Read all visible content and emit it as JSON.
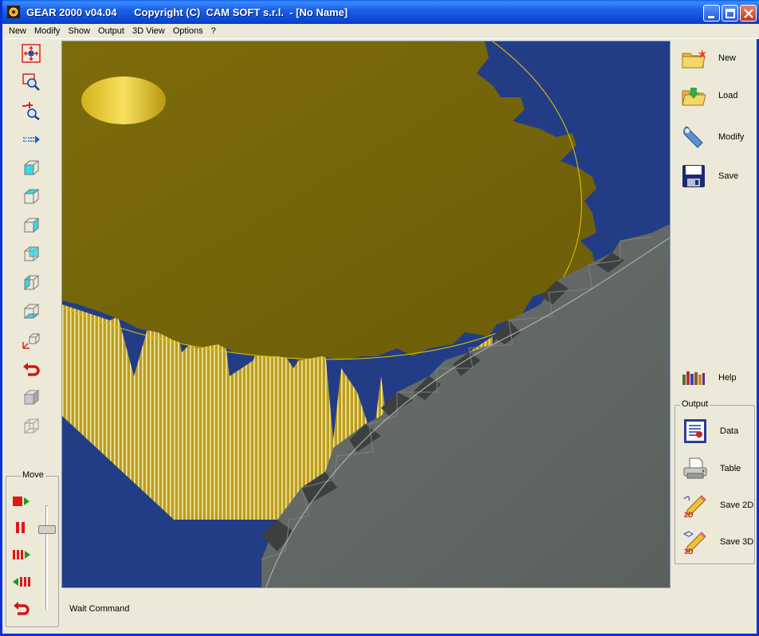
{
  "window": {
    "title": "GEAR 2000 v04.04      Copyright (C)  CAM SOFT s.r.l.  - [No Name]"
  },
  "menu": [
    "New",
    "Modify",
    "Show",
    "Output",
    "3D View",
    "Options",
    "?"
  ],
  "left_toolbar": {
    "icons": [
      "move-view-icon",
      "zoom-window-icon",
      "zoom-in-out-icon",
      "pan-arrow-icon",
      "view-front-icon",
      "view-top-icon",
      "view-right-icon",
      "view-iso-icon",
      "view-left-icon",
      "view-bottom-icon",
      "view-axes-icon",
      "undo-view-icon",
      "solid-cube-icon",
      "wireframe-cube-icon"
    ]
  },
  "move_panel": {
    "title": "Move",
    "buttons": [
      "record-play-icon",
      "pause-icon",
      "play-forward-icon",
      "play-backward-icon",
      "return-icon"
    ]
  },
  "status": {
    "text": "Wait Command"
  },
  "right_panel": {
    "buttons": [
      {
        "label": "New",
        "icon": "new-folder-icon"
      },
      {
        "label": "Load",
        "icon": "load-folder-icon"
      },
      {
        "label": "Modify",
        "icon": "wrench-icon"
      },
      {
        "label": "Save",
        "icon": "floppy-disk-icon"
      },
      {
        "label": "Help",
        "icon": "help-books-icon"
      }
    ],
    "output": {
      "title": "Output",
      "buttons": [
        {
          "label": "Data",
          "icon": "data-document-icon"
        },
        {
          "label": "Table",
          "icon": "printer-icon"
        },
        {
          "label": "Save 2D",
          "icon": "save-2d-pencil-icon"
        },
        {
          "label": "Save 3D",
          "icon": "save-3d-pencil-icon"
        }
      ]
    }
  },
  "colors": {
    "viewport_bg": "#223d85",
    "gear_gold": "#7a6a10",
    "gear_gray": "#5f6461",
    "titlebar": "#0a47d2"
  }
}
